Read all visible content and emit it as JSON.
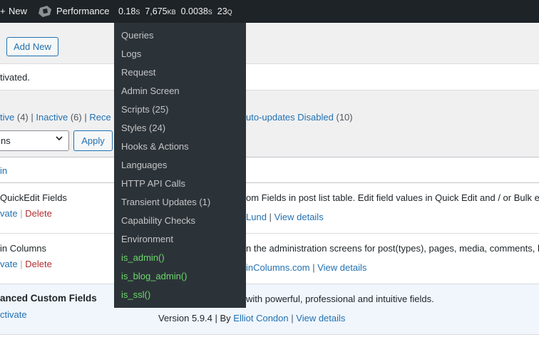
{
  "admin_bar": {
    "plus": "+",
    "new_label": "New",
    "perf_label": "Performance",
    "time": "0.18",
    "time_unit": "S",
    "memory": "7,675",
    "memory_unit": "KB",
    "query_time": "0.0038",
    "query_time_unit": "S",
    "queries": "23",
    "queries_unit": "Q"
  },
  "perf_menu": {
    "items": [
      "Queries",
      "Logs",
      "Request",
      "Admin Screen",
      "Scripts (25)",
      "Styles (24)",
      "Hooks & Actions",
      "Languages",
      "HTTP API Calls",
      "Transient Updates (1)",
      "Capability Checks",
      "Environment"
    ],
    "conditionals": [
      "is_admin()",
      "is_blog_admin()",
      "is_ssl()"
    ]
  },
  "page": {
    "add_new": "Add New",
    "notice": "tivated.",
    "filters": {
      "active": "tive",
      "active_count": "(4)",
      "sep": "|",
      "inactive": "Inactive",
      "inactive_count": "(6)",
      "recent": "Rece",
      "autoupdates_disabled": "uto-updates Disabled",
      "autoupdates_disabled_count": "(10)"
    },
    "bulk_select_value": "ns",
    "apply": "Apply",
    "column_header": "in"
  },
  "plugins": [
    {
      "name": "QuickEdit Fields",
      "action": "vate",
      "delete": "Delete",
      "description": "om Fields in post list table. Edit field values in Quick Edit and / or Bulk ed",
      "author": "Lund",
      "details": "View details"
    },
    {
      "name": "in Columns",
      "action": "vate",
      "delete": "Delete",
      "description": "n the administration screens for post(types), pages, media, comments, li",
      "author": "inColumns.com",
      "details": "View details"
    },
    {
      "name": "anced Custom Fields",
      "action": "ctivate",
      "description": "with powerful, professional and intuitive fields.",
      "version": "Version 5.9.4 | By",
      "author": "Elliot Condon",
      "details": "View details"
    }
  ]
}
